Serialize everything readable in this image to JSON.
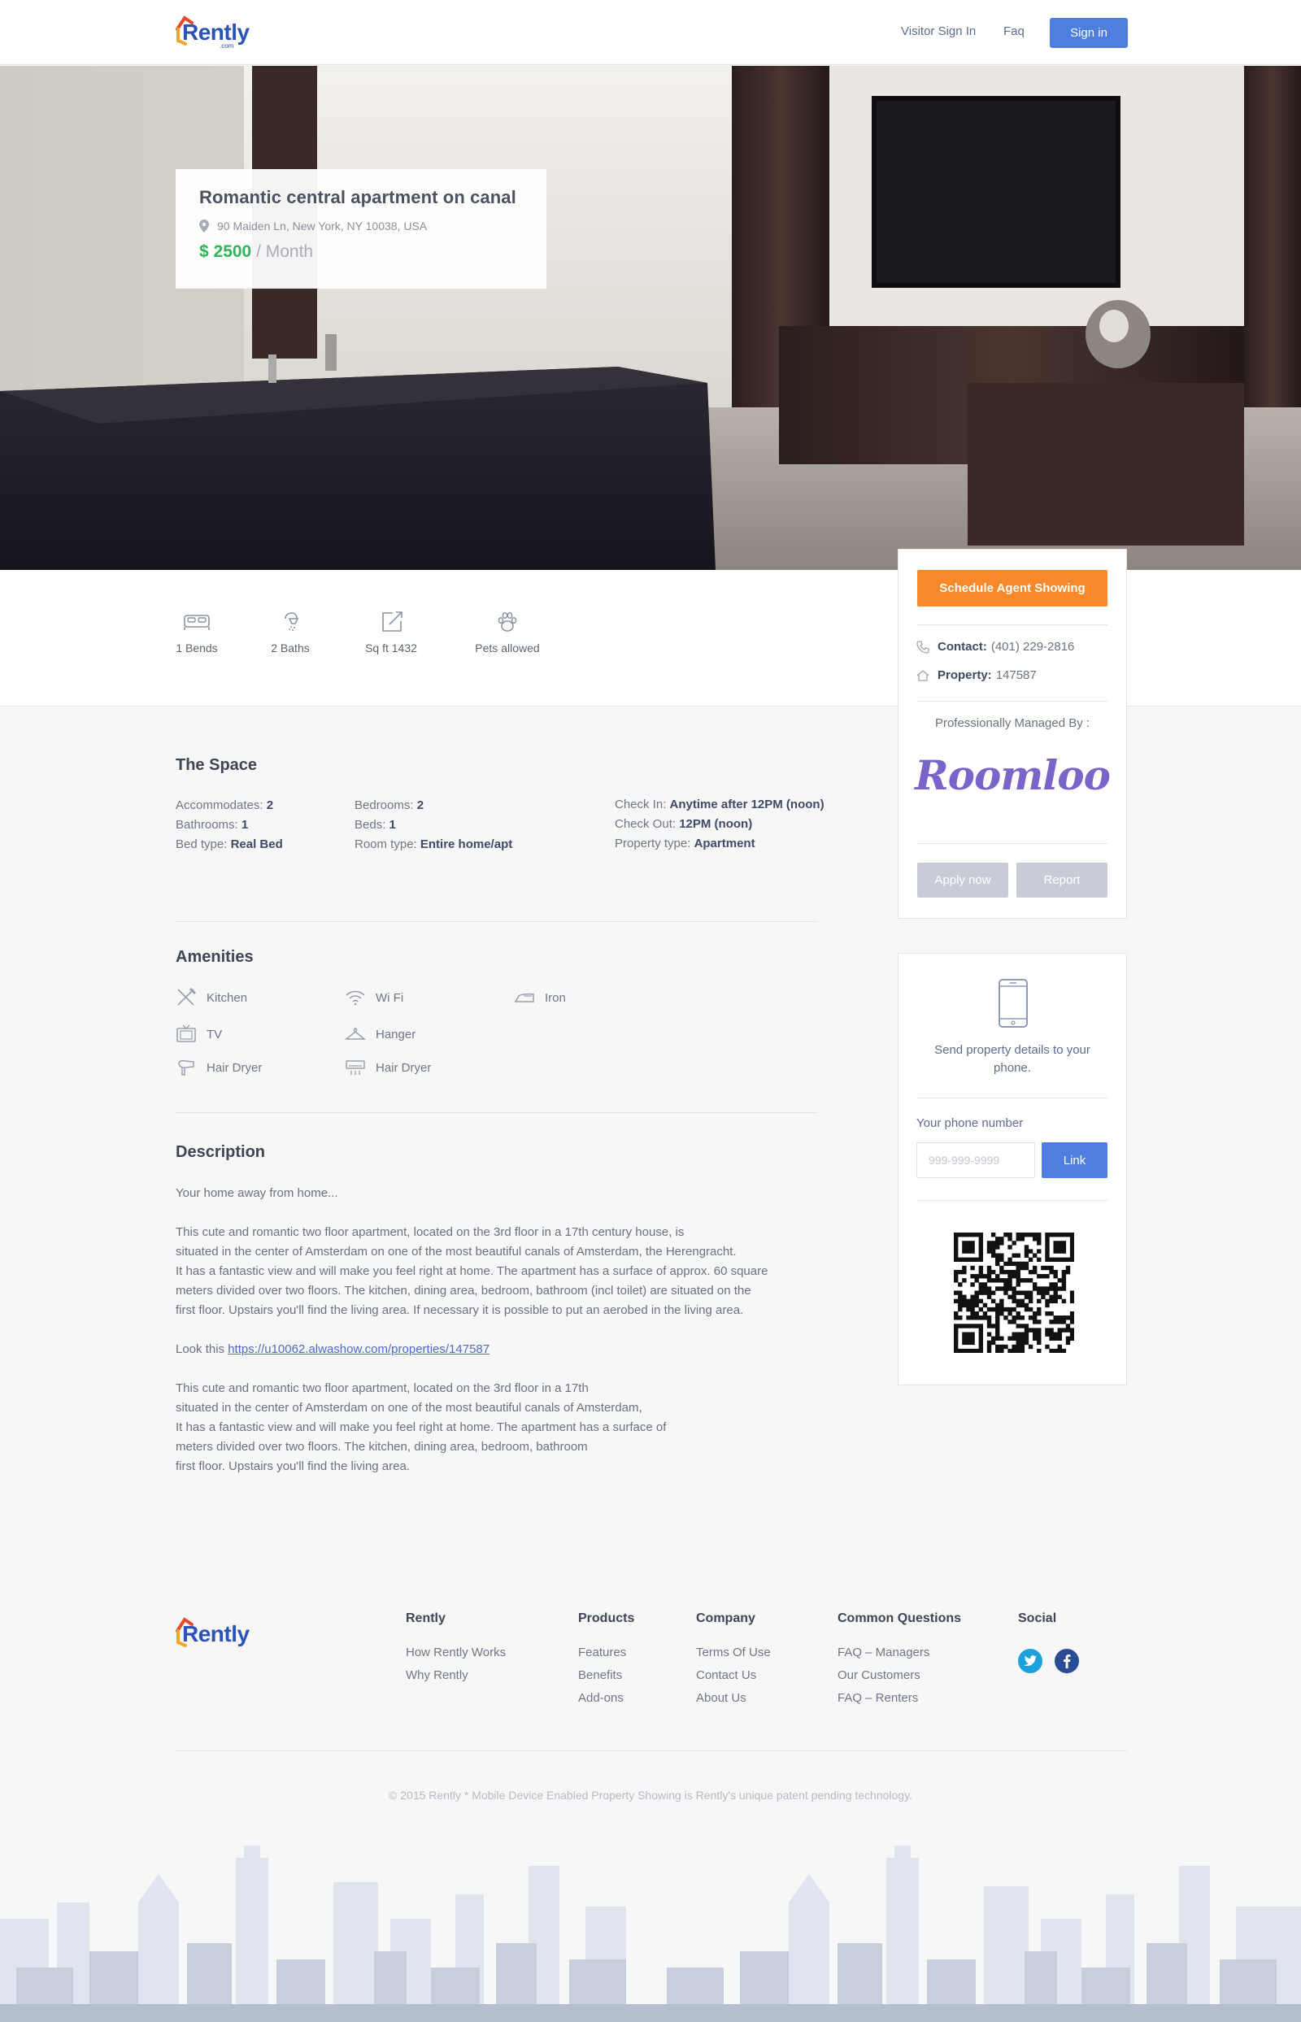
{
  "header": {
    "logo_text": "Rently",
    "logo_sub": ".com",
    "nav": [
      "Visitor Sign In",
      "Faq"
    ],
    "signin_label": "Sign in"
  },
  "listing": {
    "title": "Romantic central apartment on canal",
    "address": "90 Maiden Ln, New York, NY 10038, USA",
    "price": "$ 2500",
    "price_unit": " / Month"
  },
  "stats": [
    {
      "label": "1 Bends",
      "icon": "bed-icon"
    },
    {
      "label": "2 Baths",
      "icon": "shower-icon"
    },
    {
      "label": "Sq ft 1432",
      "icon": "area-icon"
    },
    {
      "label": "Pets allowed",
      "icon": "paw-icon"
    }
  ],
  "side": {
    "schedule_label": "Schedule Agent Showing",
    "contact_label": "Contact:",
    "contact_value": "(401) 229-2816",
    "property_label": "Property:",
    "property_value": "147587",
    "managed_label": "Professionally Managed By :",
    "manager_logo_text": "Roomloo",
    "apply_label": "Apply now",
    "report_label": "Report"
  },
  "phone_card": {
    "text": "Send property details to your phone.",
    "label": "Your phone number",
    "placeholder": "999-999-9999",
    "link_label": "Link"
  },
  "space": {
    "title": "The Space",
    "col1": [
      {
        "k": "Accommodates:",
        "v": "2"
      },
      {
        "k": "Bathrooms:",
        "v": "1"
      },
      {
        "k": "Bed type:",
        "v": "Real Bed"
      }
    ],
    "col2": [
      {
        "k": "Bedrooms:",
        "v": "2"
      },
      {
        "k": "Beds:",
        "v": "1"
      },
      {
        "k": "Room type:",
        "v": "Entire home/apt"
      }
    ],
    "col3": [
      {
        "k": "Check In:",
        "v": "Anytime after 12PM (noon)"
      },
      {
        "k": "Check Out:",
        "v": "12PM (noon)"
      },
      {
        "k": "Property type:",
        "v": "Apartment"
      }
    ]
  },
  "amenities": {
    "title": "Amenities",
    "items": [
      {
        "label": "Kitchen",
        "icon": "kitchen-icon"
      },
      {
        "label": "Wi Fi",
        "icon": "wifi-icon"
      },
      {
        "label": "Iron",
        "icon": "iron-icon"
      },
      {
        "label": "TV",
        "icon": "tv-icon"
      },
      {
        "label": "Hanger",
        "icon": "hanger-icon"
      },
      {
        "label": "Hair Dryer",
        "icon": "hair-dryer-icon"
      },
      {
        "label": "Hair Dryer",
        "icon": "air-conditioner-icon"
      }
    ]
  },
  "description": {
    "title": "Description",
    "intro": "Your home away from home...",
    "para1": [
      "This cute and romantic two floor apartment, located on the 3rd floor in a 17th century house, is",
      "situated in the center of Amsterdam on one of the most beautiful canals of Amsterdam, the Herengracht.",
      "It has a fantastic view and will make you feel right at home. The apartment has a surface of approx. 60 square",
      "meters divided over two floors. The kitchen, dining area, bedroom, bathroom (incl toilet) are situated on the",
      "first floor. Upstairs you'll find the living area. If necessary it is possible to put an aerobed in the living area."
    ],
    "look_prefix": "Look this ",
    "look_link": "https://u10062.alwashow.com/properties/147587",
    "para2": [
      "This cute and romantic two floor apartment, located on the 3rd floor in a 17th",
      "situated in the center of Amsterdam on one of the most beautiful canals of Amsterdam,",
      "It has a fantastic view and will make you feel right at home. The apartment has a surface of",
      "meters divided over two floors. The kitchen, dining area, bedroom, bathroom",
      "first floor. Upstairs you'll find the living area."
    ]
  },
  "footer": {
    "logo_text": "Rently",
    "columns": [
      {
        "title": "Rently",
        "links": [
          "How Rently Works",
          "Why Rently"
        ]
      },
      {
        "title": "Products",
        "links": [
          "Features",
          "Benefits",
          "Add-ons"
        ]
      },
      {
        "title": "Company",
        "links": [
          "Terms Of Use",
          "Contact Us",
          "About Us"
        ]
      },
      {
        "title": "Common Questions",
        "links": [
          "FAQ – Managers",
          "Our Customers",
          "FAQ – Renters"
        ]
      },
      {
        "title": "Social",
        "links": []
      }
    ],
    "social_icons": [
      "twitter-icon",
      "facebook-icon"
    ],
    "copyright": "© 2015 Rently * Mobile Device Enabled Property Showing is Rently's unique patent pending technology."
  },
  "colors": {
    "accent": "#4d7ee0",
    "orange": "#f7892a",
    "price_green": "#2fb35b",
    "roomloo_purple": "#7a63c9"
  }
}
